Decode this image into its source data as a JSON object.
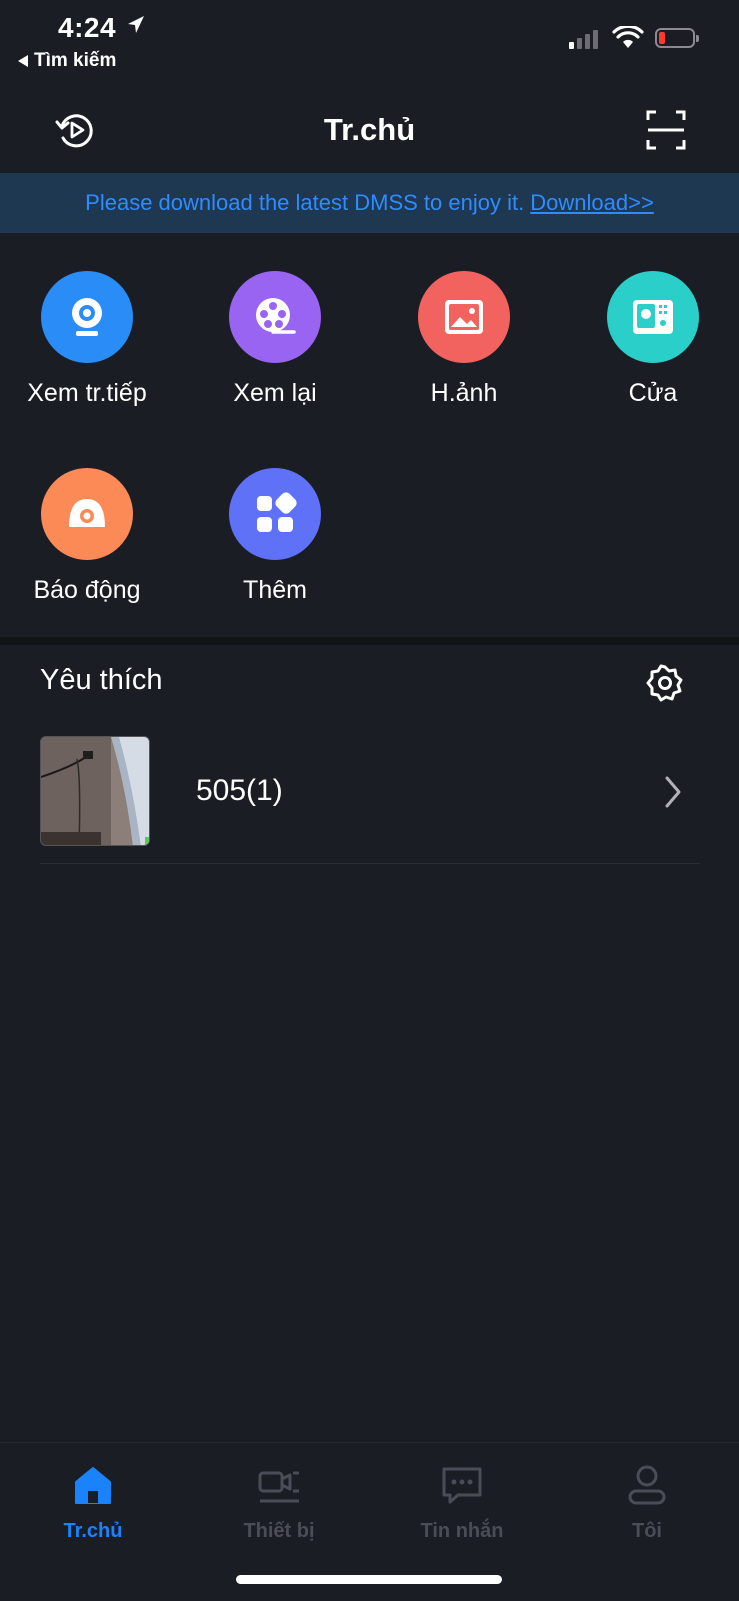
{
  "status": {
    "time": "4:24",
    "back_app": "Tìm kiếm"
  },
  "nav": {
    "title": "Tr.chủ"
  },
  "banner": {
    "text": "Please download the latest DMSS to enjoy it. ",
    "link": "Download>>"
  },
  "menu": [
    {
      "label": "Xem tr.tiếp",
      "icon": "live-camera-icon",
      "color": "#2a8cf6"
    },
    {
      "label": "Xem lại",
      "icon": "film-reel-icon",
      "color": "#9a64f2"
    },
    {
      "label": "H.ảnh",
      "icon": "image-icon",
      "color": "#f2625f"
    },
    {
      "label": "Cửa",
      "icon": "door-intercom-icon",
      "color": "#2bcfc9"
    },
    {
      "label": "Báo động",
      "icon": "alarm-icon",
      "color": "#fb8a57"
    },
    {
      "label": "Thêm",
      "icon": "more-apps-icon",
      "color": "#5f71f6"
    }
  ],
  "favorites": {
    "title": "Yêu thích",
    "items": [
      {
        "name": "505(1)"
      }
    ]
  },
  "tabs": [
    {
      "label": "Tr.chủ",
      "icon": "home-icon",
      "active": true
    },
    {
      "label": "Thiết bị",
      "icon": "device-icon",
      "active": false
    },
    {
      "label": "Tin nhắn",
      "icon": "message-icon",
      "active": false
    },
    {
      "label": "Tôi",
      "icon": "profile-icon",
      "active": false
    }
  ],
  "colors": {
    "accent": "#1a82fb",
    "background": "#1b1d24",
    "inactive_tab": "#4a4d57"
  }
}
